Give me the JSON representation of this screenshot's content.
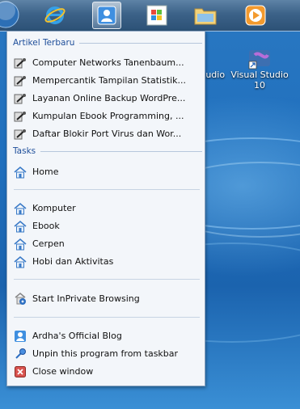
{
  "taskbar": {
    "buttons": [
      {
        "name": "start-orb"
      },
      {
        "name": "internet-explorer"
      },
      {
        "name": "user-profile"
      },
      {
        "name": "windows-explorer-flag"
      },
      {
        "name": "folder"
      },
      {
        "name": "media-player"
      }
    ]
  },
  "desktop": {
    "icons": [
      {
        "label_line1": "Visual Studio",
        "label_line2": "10"
      },
      {
        "label_line1": "tudio"
      }
    ]
  },
  "jumplist": {
    "recent_header": "Artikel Terbaru",
    "recent": [
      "Computer Networks Tanenbaum...",
      "Mempercantik Tampilan Statistik...",
      "Layanan Online Backup WordPre...",
      "Kumpulan Ebook Programming, ...",
      "Daftar Blokir Port Virus dan Wor..."
    ],
    "tasks_header": "Tasks",
    "tasks_group1": [
      "Home"
    ],
    "tasks_group2": [
      "Komputer",
      "Ebook",
      "Cerpen",
      "Hobi dan Aktivitas"
    ],
    "tasks_group3": [
      "Start InPrivate Browsing"
    ],
    "footer": [
      {
        "label": "Ardha's Official Blog",
        "icon": "blog-icon"
      },
      {
        "label": "Unpin this program from taskbar",
        "icon": "unpin-icon"
      },
      {
        "label": "Close window",
        "icon": "close-icon"
      }
    ]
  },
  "colors": {
    "accent": "#1e4e9a",
    "panel": "#f3f6fa"
  }
}
